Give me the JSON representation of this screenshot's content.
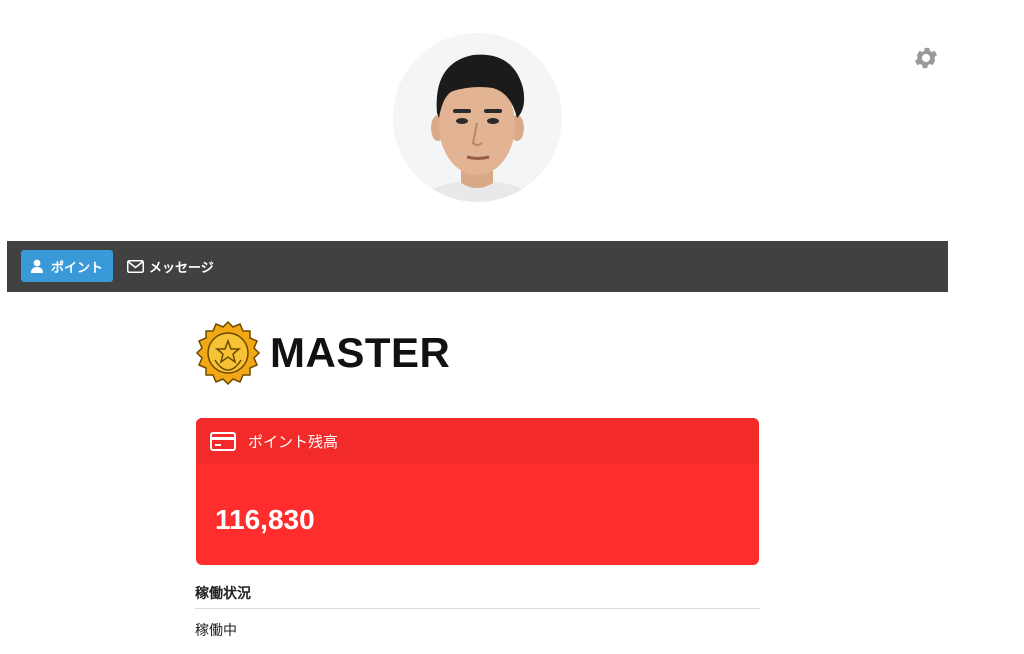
{
  "profile": {
    "avatar_icon": "user-photo-avatar",
    "settings_icon": "gear-icon"
  },
  "nav": {
    "points_label": "ポイント",
    "points_icon": "user-icon",
    "message_label": "メッセージ",
    "message_icon": "envelope-icon",
    "bar_color": "#414141",
    "active_color": "#3a9ad9"
  },
  "rank": {
    "title": "MASTER",
    "icon": "gold-medal-star-icon"
  },
  "points_card": {
    "header_label": "ポイント残高",
    "header_icon": "credit-card-icon",
    "balance": "116,830",
    "background": "#ff2d2d"
  },
  "status": {
    "label": "稼働状況",
    "value": "稼働中"
  }
}
